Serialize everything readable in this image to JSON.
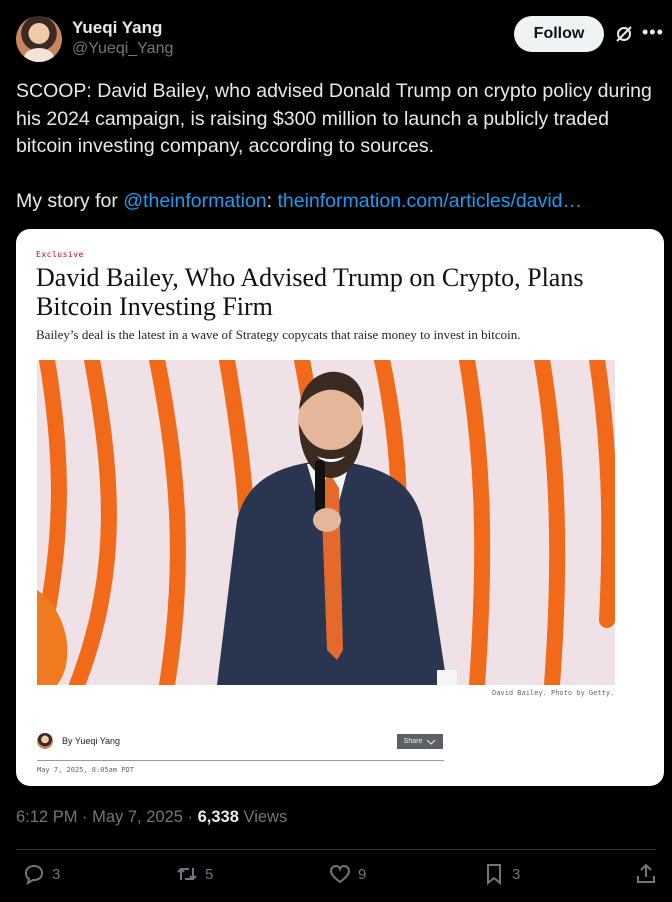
{
  "author": {
    "name": "Yueqi Yang",
    "handle": "@Yueqi_Yang"
  },
  "follow_label": "Follow",
  "tweet": {
    "line1": "SCOOP: David Bailey, who advised Donald Trump on crypto policy during his 2024 campaign, is raising $300 million to launch a publicly traded bitcoin investing company, according to sources.",
    "story_prefix": "My story for ",
    "mention": "@theinformation",
    "colon": ":  ",
    "url": "theinformation.com/articles/david…"
  },
  "card": {
    "kicker": "Exclusive",
    "headline": "David Bailey, Who Advised Trump on Crypto, Plans Bitcoin Investing Firm",
    "dek": "Bailey’s deal is the latest in a wave of Strategy copycats that raise money to invest in bitcoin.",
    "caption": "David Bailey. Photo by Getty.",
    "byline": "By Yueqi Yang",
    "share_label": "Share",
    "date": "May 7, 2025, 8:05am PDT"
  },
  "meta": {
    "time": "6:12 PM",
    "separator": " · ",
    "date": "May 7, 2025",
    "views_count": "6,338",
    "views_label": " Views"
  },
  "actions": {
    "replies": "3",
    "reposts": "5",
    "likes": "9",
    "bookmarks": "3"
  },
  "icons": {
    "reply": "reply-icon",
    "repost": "repost-icon",
    "like": "heart-icon",
    "bookmark": "bookmark-icon",
    "share": "share-icon",
    "grok": "grok-icon",
    "more": "more-icon"
  },
  "colors": {
    "link": "#1d9bf0",
    "muted": "#71767b",
    "kicker": "#d0002a"
  }
}
